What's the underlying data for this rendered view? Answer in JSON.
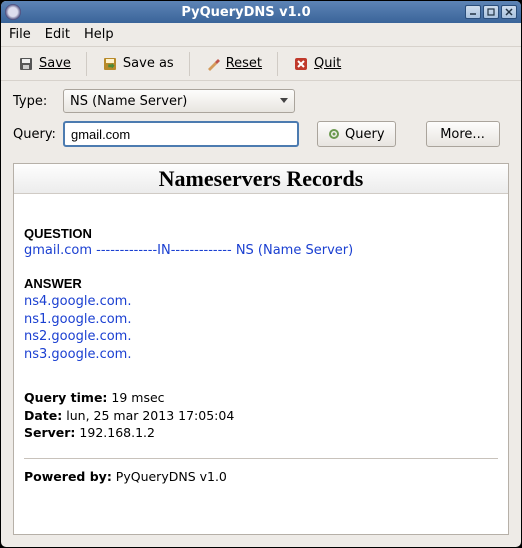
{
  "window": {
    "title": "PyQueryDNS v1.0"
  },
  "menubar": [
    "File",
    "Edit",
    "Help"
  ],
  "toolbar": {
    "save": "Save",
    "saveas": "Save as",
    "reset": "Reset",
    "quit": "Quit"
  },
  "form": {
    "type_label": "Type:",
    "type_value": "NS (Name Server)",
    "query_label": "Query:",
    "query_value": "gmail.com",
    "query_button": "Query",
    "more_button": "More..."
  },
  "results": {
    "heading": "Nameservers Records",
    "question_label": "QUESTION",
    "question": {
      "name": "gmail.com",
      "sep": " -------------IN------------- ",
      "type": "NS (Name Server)"
    },
    "answer_label": "ANSWER",
    "answers": [
      "ns4.google.com.",
      "ns1.google.com.",
      "ns2.google.com.",
      "ns3.google.com."
    ],
    "meta": {
      "query_time_label": "Query time:",
      "query_time": "19 msec",
      "date_label": "Date:",
      "date": "lun, 25 mar 2013 17:05:04",
      "server_label": "Server:",
      "server": "192.168.1.2"
    },
    "powered_label": "Powered by:",
    "powered": "PyQueryDNS v1.0"
  }
}
